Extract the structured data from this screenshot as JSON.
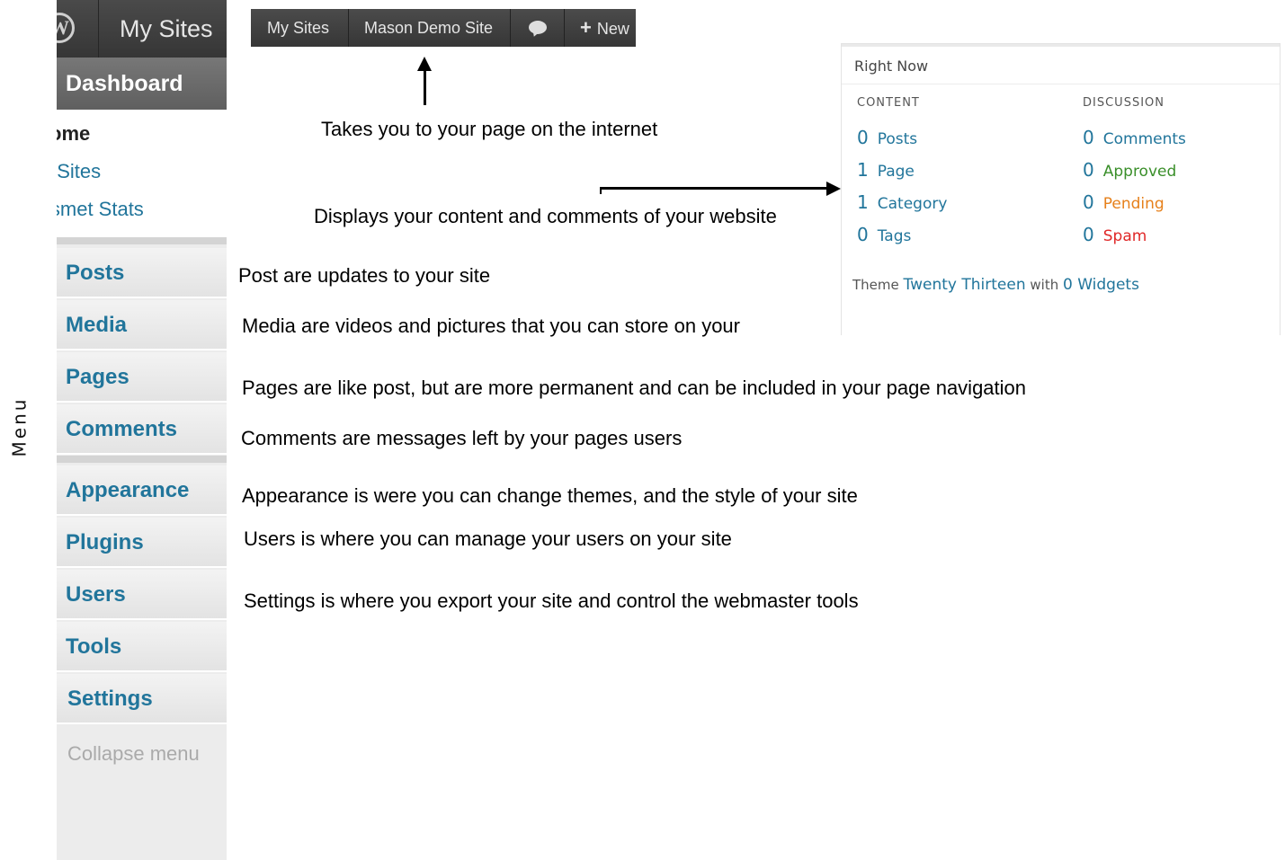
{
  "menu_label": "Menu",
  "sidebar": {
    "wp_logo": "W",
    "top_label": "My Sites",
    "dashboard": "Dashboard",
    "sub_items": [
      "ome",
      "/ Sites",
      "ismet Stats"
    ],
    "items": [
      "Posts",
      "Media",
      "Pages",
      "Comments",
      "Appearance",
      "Plugins",
      "Users",
      "Tools",
      "Settings"
    ],
    "collapse": "Collapse menu"
  },
  "adminbar": {
    "my_sites": "My Sites",
    "site_name": "Mason Demo Site",
    "new_label": "New",
    "plus_icon": "+"
  },
  "annotations": {
    "site_link": "Takes you to your page on the internet",
    "right_now": "Displays your content and comments of your website",
    "posts": "Post are updates to your site",
    "media": "Media are videos and pictures that you can store on your",
    "pages": "Pages are like post, but are more permanent and can be included in your page navigation",
    "comments": "Comments are messages left by your pages users",
    "appearance": "Appearance is were you can change themes, and the style of your site",
    "users": "Users is where you can manage your users on your site",
    "settings": "Settings is where you export your site and control the webmaster tools"
  },
  "right_now": {
    "title": "Right Now",
    "content_header": "CONTENT",
    "discussion_header": "DISCUSSION",
    "content": [
      {
        "num": "0",
        "label": "Posts"
      },
      {
        "num": "1",
        "label": "Page"
      },
      {
        "num": "1",
        "label": "Category"
      },
      {
        "num": "0",
        "label": "Tags"
      }
    ],
    "discussion": [
      {
        "num": "0",
        "label": "Comments",
        "color": "#21759b"
      },
      {
        "num": "0",
        "label": "Approved",
        "color": "#3a8f2a"
      },
      {
        "num": "0",
        "label": "Pending",
        "color": "#e6801b"
      },
      {
        "num": "0",
        "label": "Spam",
        "color": "#e02828"
      }
    ],
    "theme_prefix": "Theme",
    "theme_name": "Twenty Thirteen",
    "theme_with": "with",
    "widgets": "0 Widgets"
  }
}
